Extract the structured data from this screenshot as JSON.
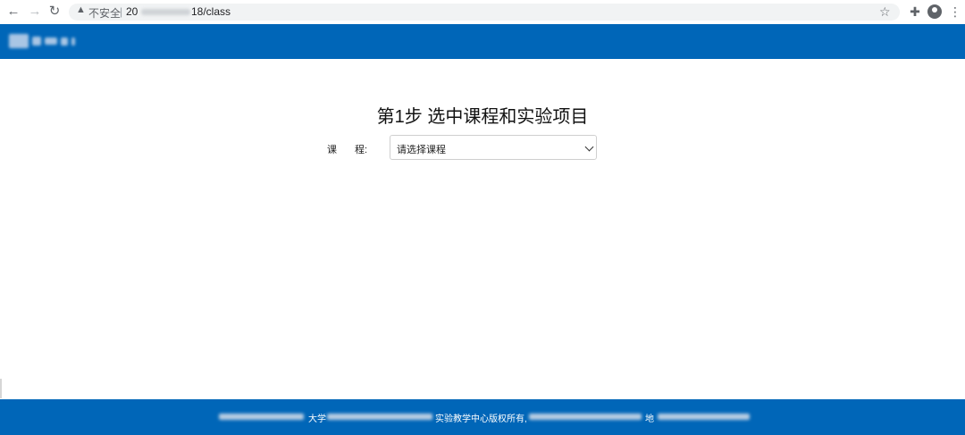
{
  "browser": {
    "secure_warning": "不安全",
    "url_prefix": "20",
    "url_suffix": "18/class"
  },
  "page": {
    "title": "第1步 选中课程和实验项目"
  },
  "form": {
    "course_label_part1": "课",
    "course_label_part2": "程:",
    "course_select_value": "请选择课程"
  },
  "footer": {
    "text_part1": "大学",
    "text_part2": "实验教学中心版权所有,",
    "text_part3": "地"
  },
  "colors": {
    "brand_blue": "#0066b8"
  }
}
